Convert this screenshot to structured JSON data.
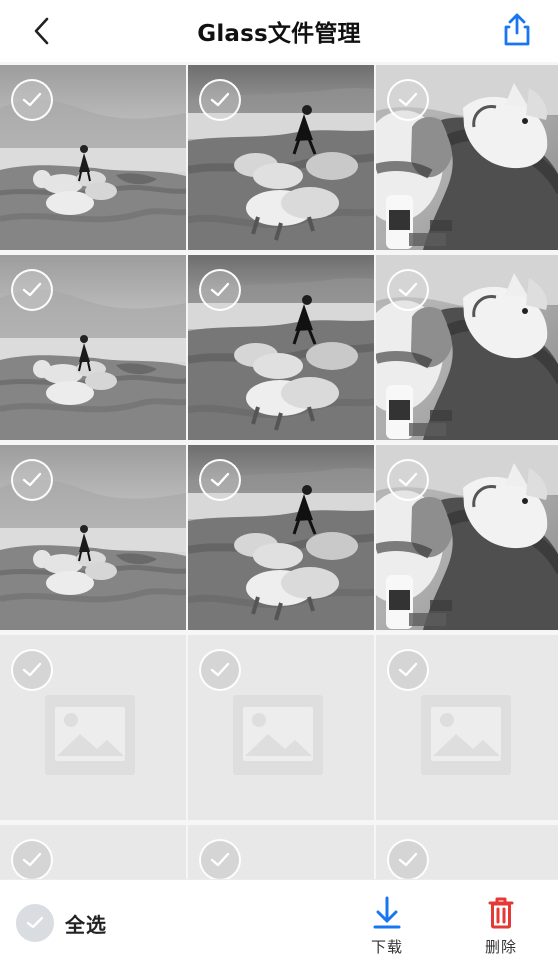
{
  "header": {
    "title": "Glass文件管理",
    "back_icon": "back-icon",
    "share_icon": "share-icon",
    "accent_color": "#1976f2"
  },
  "grid": {
    "columns": 3,
    "visible_rows": 5,
    "tiles": [
      {
        "type": "photo",
        "photo": "lakeside-pigs-wide",
        "selected": false
      },
      {
        "type": "photo",
        "photo": "lakeside-pigs-close",
        "selected": false
      },
      {
        "type": "photo",
        "photo": "man-with-pig",
        "selected": false
      },
      {
        "type": "photo",
        "photo": "lakeside-pigs-wide",
        "selected": false
      },
      {
        "type": "photo",
        "photo": "lakeside-pigs-close",
        "selected": false
      },
      {
        "type": "photo",
        "photo": "man-with-pig",
        "selected": false
      },
      {
        "type": "photo",
        "photo": "lakeside-pigs-wide",
        "selected": false
      },
      {
        "type": "photo",
        "photo": "lakeside-pigs-close",
        "selected": false
      },
      {
        "type": "photo",
        "photo": "man-with-pig",
        "selected": false
      },
      {
        "type": "placeholder",
        "photo": "image-placeholder-icon",
        "selected": false
      },
      {
        "type": "placeholder",
        "photo": "image-placeholder-icon",
        "selected": false
      },
      {
        "type": "placeholder",
        "photo": "image-placeholder-icon",
        "selected": false
      },
      {
        "type": "placeholder",
        "photo": "image-placeholder-icon",
        "selected": false
      },
      {
        "type": "placeholder",
        "photo": "image-placeholder-icon",
        "selected": false
      },
      {
        "type": "placeholder",
        "photo": "image-placeholder-icon",
        "selected": false
      }
    ]
  },
  "footer": {
    "select_all_label": "全选",
    "download_label": "下载",
    "delete_label": "删除",
    "download_color": "#1976f2",
    "delete_color": "#e53935"
  }
}
